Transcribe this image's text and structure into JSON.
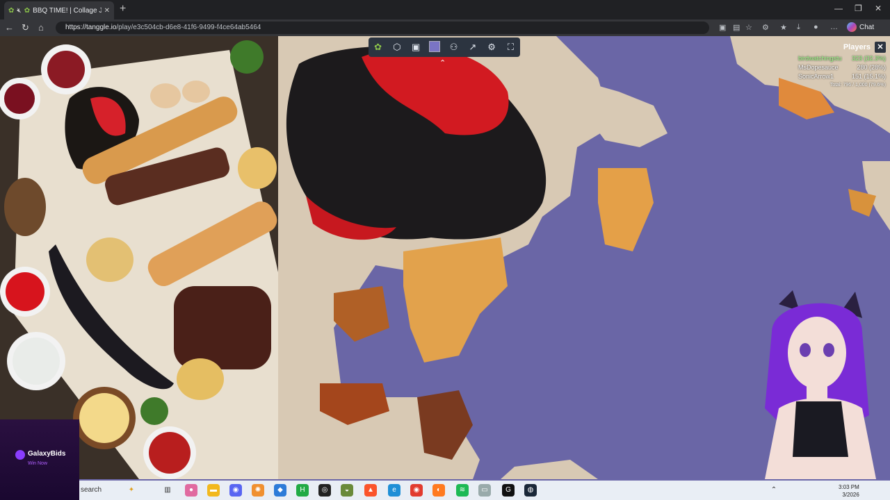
{
  "browser": {
    "tab_title": "BBQ TIME! | Collage Jigsaw",
    "url_host": "https://tanggle.io",
    "url_path": "/play/e3c504cb-d6e8-41f6-9499-f4ce64ab5464",
    "chat_label": "Chat"
  },
  "game": {
    "players_label": "Players",
    "players": [
      {
        "name": "birdwatchingstu",
        "score": "323 (32.3%)"
      },
      {
        "name": "MsDopesauce",
        "score": "280 (28%)"
      },
      {
        "name": "SonicArrow1",
        "score": "151 (15.1%)"
      }
    ],
    "total": "Total: 796 / 1,000 (79.6%)"
  },
  "ad": {
    "brand": "GalaxyBids",
    "cta": "Win Now"
  },
  "taskbar": {
    "search": "search",
    "time": "3:03 PM",
    "date": "3/2026"
  },
  "colors": {
    "accent": "#2c3440",
    "board_bg": "#6a66a6",
    "leader": "#9dff8a"
  }
}
